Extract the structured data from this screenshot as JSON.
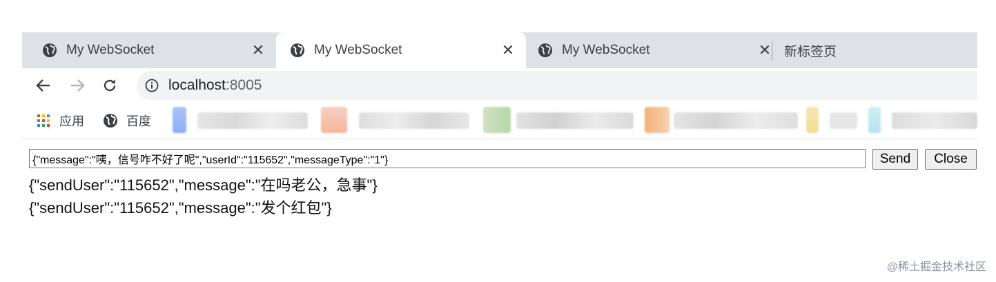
{
  "browser": {
    "tabs": [
      {
        "title": "My WebSocket",
        "icon": "globe-icon",
        "close": "✕",
        "active": false
      },
      {
        "title": "My WebSocket",
        "icon": "globe-icon",
        "close": "✕",
        "active": true
      },
      {
        "title": "My WebSocket",
        "icon": "globe-icon",
        "close": "✕",
        "active": false
      },
      {
        "title": "新标签页",
        "active": false
      }
    ],
    "address": {
      "host": "localhost",
      "port": ":8005"
    },
    "bookmarks": [
      {
        "label": "应用",
        "icon": "apps-grid-icon"
      },
      {
        "label": "百度",
        "icon": "globe-icon"
      }
    ]
  },
  "page": {
    "input_value": "{\"message\":\"咦，信号咋不好了呢\",\"userId\":\"115652\",\"messageType\":\"1\"}",
    "send_label": "Send",
    "close_label": "Close",
    "messages": [
      "{\"sendUser\":\"115652\",\"message\":\"在吗老公，急事\"}",
      "{\"sendUser\":\"115652\",\"message\":\"发个红包\"}"
    ]
  },
  "watermark": "@稀土掘金技术社区"
}
